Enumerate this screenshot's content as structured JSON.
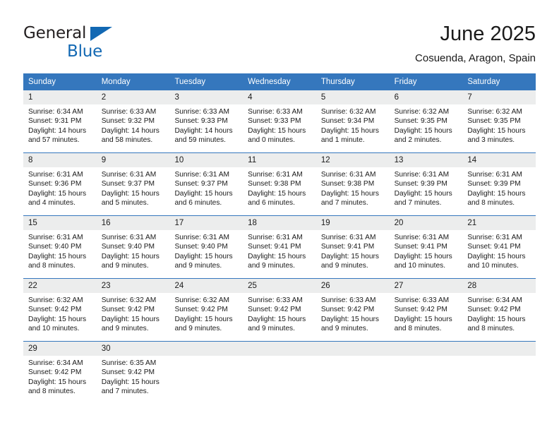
{
  "logo": {
    "word_one": "General",
    "word_two": "Blue",
    "triangle_color": "#1268b3",
    "text_color": "#231f20"
  },
  "header": {
    "title": "June 2025",
    "subtitle": "Cosuenda, Aragon, Spain"
  },
  "theme": {
    "header_bg": "#3577bd",
    "daynum_bg": "#eceded",
    "text": "#1a1a1a"
  },
  "calendar": {
    "weekday_headers": [
      "Sunday",
      "Monday",
      "Tuesday",
      "Wednesday",
      "Thursday",
      "Friday",
      "Saturday"
    ],
    "weeks": [
      [
        {
          "day": "1",
          "text": "Sunrise: 6:34 AM\nSunset: 9:31 PM\nDaylight: 14 hours\nand 57 minutes."
        },
        {
          "day": "2",
          "text": "Sunrise: 6:33 AM\nSunset: 9:32 PM\nDaylight: 14 hours\nand 58 minutes."
        },
        {
          "day": "3",
          "text": "Sunrise: 6:33 AM\nSunset: 9:33 PM\nDaylight: 14 hours\nand 59 minutes."
        },
        {
          "day": "4",
          "text": "Sunrise: 6:33 AM\nSunset: 9:33 PM\nDaylight: 15 hours\nand 0 minutes."
        },
        {
          "day": "5",
          "text": "Sunrise: 6:32 AM\nSunset: 9:34 PM\nDaylight: 15 hours\nand 1 minute."
        },
        {
          "day": "6",
          "text": "Sunrise: 6:32 AM\nSunset: 9:35 PM\nDaylight: 15 hours\nand 2 minutes."
        },
        {
          "day": "7",
          "text": "Sunrise: 6:32 AM\nSunset: 9:35 PM\nDaylight: 15 hours\nand 3 minutes."
        }
      ],
      [
        {
          "day": "8",
          "text": "Sunrise: 6:31 AM\nSunset: 9:36 PM\nDaylight: 15 hours\nand 4 minutes."
        },
        {
          "day": "9",
          "text": "Sunrise: 6:31 AM\nSunset: 9:37 PM\nDaylight: 15 hours\nand 5 minutes."
        },
        {
          "day": "10",
          "text": "Sunrise: 6:31 AM\nSunset: 9:37 PM\nDaylight: 15 hours\nand 6 minutes."
        },
        {
          "day": "11",
          "text": "Sunrise: 6:31 AM\nSunset: 9:38 PM\nDaylight: 15 hours\nand 6 minutes."
        },
        {
          "day": "12",
          "text": "Sunrise: 6:31 AM\nSunset: 9:38 PM\nDaylight: 15 hours\nand 7 minutes."
        },
        {
          "day": "13",
          "text": "Sunrise: 6:31 AM\nSunset: 9:39 PM\nDaylight: 15 hours\nand 7 minutes."
        },
        {
          "day": "14",
          "text": "Sunrise: 6:31 AM\nSunset: 9:39 PM\nDaylight: 15 hours\nand 8 minutes."
        }
      ],
      [
        {
          "day": "15",
          "text": "Sunrise: 6:31 AM\nSunset: 9:40 PM\nDaylight: 15 hours\nand 8 minutes."
        },
        {
          "day": "16",
          "text": "Sunrise: 6:31 AM\nSunset: 9:40 PM\nDaylight: 15 hours\nand 9 minutes."
        },
        {
          "day": "17",
          "text": "Sunrise: 6:31 AM\nSunset: 9:40 PM\nDaylight: 15 hours\nand 9 minutes."
        },
        {
          "day": "18",
          "text": "Sunrise: 6:31 AM\nSunset: 9:41 PM\nDaylight: 15 hours\nand 9 minutes."
        },
        {
          "day": "19",
          "text": "Sunrise: 6:31 AM\nSunset: 9:41 PM\nDaylight: 15 hours\nand 9 minutes."
        },
        {
          "day": "20",
          "text": "Sunrise: 6:31 AM\nSunset: 9:41 PM\nDaylight: 15 hours\nand 10 minutes."
        },
        {
          "day": "21",
          "text": "Sunrise: 6:31 AM\nSunset: 9:41 PM\nDaylight: 15 hours\nand 10 minutes."
        }
      ],
      [
        {
          "day": "22",
          "text": "Sunrise: 6:32 AM\nSunset: 9:42 PM\nDaylight: 15 hours\nand 10 minutes."
        },
        {
          "day": "23",
          "text": "Sunrise: 6:32 AM\nSunset: 9:42 PM\nDaylight: 15 hours\nand 9 minutes."
        },
        {
          "day": "24",
          "text": "Sunrise: 6:32 AM\nSunset: 9:42 PM\nDaylight: 15 hours\nand 9 minutes."
        },
        {
          "day": "25",
          "text": "Sunrise: 6:33 AM\nSunset: 9:42 PM\nDaylight: 15 hours\nand 9 minutes."
        },
        {
          "day": "26",
          "text": "Sunrise: 6:33 AM\nSunset: 9:42 PM\nDaylight: 15 hours\nand 9 minutes."
        },
        {
          "day": "27",
          "text": "Sunrise: 6:33 AM\nSunset: 9:42 PM\nDaylight: 15 hours\nand 8 minutes."
        },
        {
          "day": "28",
          "text": "Sunrise: 6:34 AM\nSunset: 9:42 PM\nDaylight: 15 hours\nand 8 minutes."
        }
      ],
      [
        {
          "day": "29",
          "text": "Sunrise: 6:34 AM\nSunset: 9:42 PM\nDaylight: 15 hours\nand 8 minutes."
        },
        {
          "day": "30",
          "text": "Sunrise: 6:35 AM\nSunset: 9:42 PM\nDaylight: 15 hours\nand 7 minutes."
        },
        {
          "day": "",
          "text": ""
        },
        {
          "day": "",
          "text": ""
        },
        {
          "day": "",
          "text": ""
        },
        {
          "day": "",
          "text": ""
        },
        {
          "day": "",
          "text": ""
        }
      ]
    ]
  }
}
